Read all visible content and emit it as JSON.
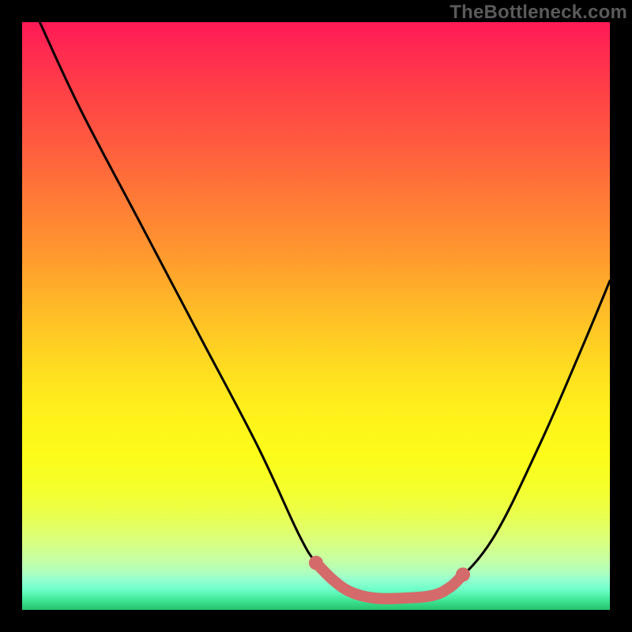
{
  "watermark": "TheBottleneck.com",
  "chart_data": {
    "type": "line",
    "title": "",
    "xlabel": "",
    "ylabel": "",
    "xlim": [
      0,
      100
    ],
    "ylim": [
      0,
      100
    ],
    "grid": false,
    "legend": false,
    "series": [
      {
        "name": "bottleneck-curve",
        "color": "#000000",
        "x": [
          3,
          10,
          20,
          30,
          40,
          47,
          50,
          53,
          56,
          60,
          65,
          70,
          73,
          80,
          88,
          95,
          100
        ],
        "values": [
          100,
          85,
          66,
          47,
          28,
          13,
          8,
          5,
          3,
          2,
          2,
          2.5,
          4,
          12,
          28,
          44,
          56
        ]
      },
      {
        "name": "optimal-zone",
        "color": "#d46a6a",
        "x": [
          50,
          53,
          56,
          60,
          65,
          70,
          73,
          75
        ],
        "values": [
          8,
          5,
          3,
          2,
          2,
          2.5,
          4,
          6
        ]
      }
    ],
    "gradient": {
      "top_color": "#ff1a56",
      "mid_color": "#ffe61e",
      "bottom_color": "#24c26d"
    }
  }
}
